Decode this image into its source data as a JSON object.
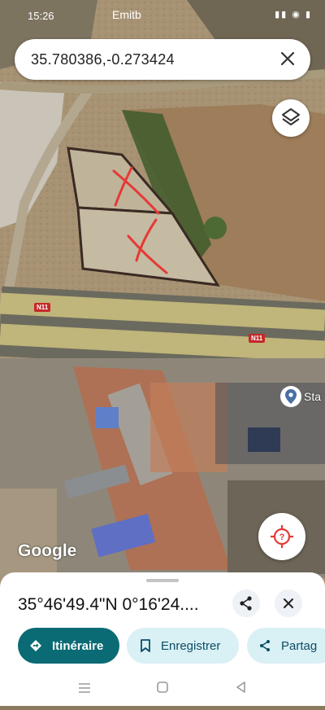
{
  "status_bar": {
    "time": "15:26",
    "carrier": "Emitb",
    "system_icons": "wifi signal battery"
  },
  "search": {
    "value": "35.780386,-0.273424"
  },
  "map": {
    "road_label_1": "N11",
    "road_label_2": "N11",
    "place_label": "Sta",
    "attribution": "Google"
  },
  "sheet": {
    "coordinates": "35°46'49.4\"N 0°16'24....",
    "actions": {
      "directions": "Itinéraire",
      "save": "Enregistrer",
      "share": "Partag"
    }
  },
  "colors": {
    "accent": "#0b6b74",
    "accent_light": "#d9f0f4",
    "marker_red": "#e53935"
  }
}
